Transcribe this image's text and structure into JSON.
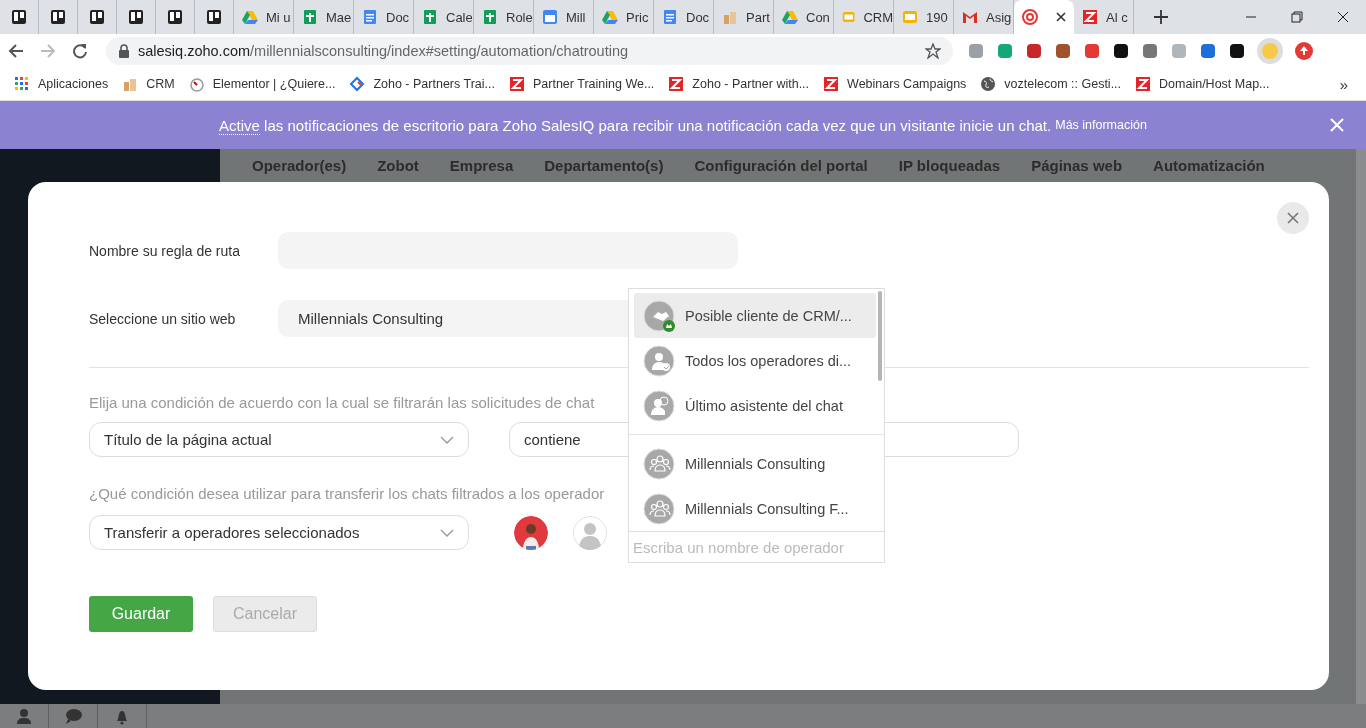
{
  "browser": {
    "tabs": [
      {
        "kind": "board",
        "selected": false
      },
      {
        "kind": "board",
        "selected": false
      },
      {
        "kind": "board",
        "selected": false
      },
      {
        "kind": "board",
        "selected": false
      },
      {
        "kind": "board",
        "selected": false
      },
      {
        "kind": "board",
        "selected": false
      },
      {
        "kind": "drive",
        "title": "Mi u",
        "selected": false
      },
      {
        "kind": "sheets",
        "title": "Mae",
        "selected": false
      },
      {
        "kind": "docs",
        "title": "Doc",
        "selected": false
      },
      {
        "kind": "sheets",
        "title": "Cale",
        "selected": false
      },
      {
        "kind": "sheets",
        "title": "Role",
        "selected": false
      },
      {
        "kind": "calendar",
        "title": "Mill",
        "selected": false
      },
      {
        "kind": "drive",
        "title": "Pric",
        "selected": false
      },
      {
        "kind": "docs",
        "title": "Doc",
        "selected": false
      },
      {
        "kind": "misc",
        "title": "Part",
        "selected": false
      },
      {
        "kind": "drive",
        "title": "Con",
        "selected": false
      },
      {
        "kind": "slides",
        "title": "CRM",
        "selected": false
      },
      {
        "kind": "slides",
        "title": "190",
        "selected": false
      },
      {
        "kind": "gmail",
        "title": "Asig",
        "selected": false
      },
      {
        "kind": "target",
        "selected": true
      },
      {
        "kind": "zoho",
        "title": "Al c",
        "selected": false
      }
    ],
    "url_host": "salesiq.zoho.com",
    "url_path": "/millennialsconsulting/index#setting/automation/chatrouting",
    "bookmarks": [
      {
        "kind": "apps",
        "title": "Aplicaciones"
      },
      {
        "kind": "misc",
        "title": "CRM"
      },
      {
        "kind": "page",
        "title": "Elementor | ¿Quiere..."
      },
      {
        "kind": "diamond",
        "title": "Zoho - Partners Trai..."
      },
      {
        "kind": "zoho",
        "title": "Partner Training We..."
      },
      {
        "kind": "zoho",
        "title": "Zoho - Partner with..."
      },
      {
        "kind": "zoho",
        "title": "Webinars Campaigns"
      },
      {
        "kind": "globe",
        "title": "voztelecom :: Gesti..."
      },
      {
        "kind": "zoho",
        "title": "Domain/Host Map..."
      }
    ],
    "bookmarks_more": "»"
  },
  "banner": {
    "link": "Active",
    "text": " las notificaciones de escritorio para Zoho SalesIQ para recibir una notificación cada vez que un visitante inicie un chat.",
    "more": "Más información"
  },
  "nav": [
    "Operador(es)",
    "Zobot",
    "Empresa",
    "Departamento(s)",
    "Configuración del portal",
    "IP bloqueadas",
    "Páginas web",
    "Automatización"
  ],
  "modal": {
    "name_label": "Nombre su regla de ruta",
    "site_label": "Seleccione un sitio web",
    "site_value": "Millennials Consulting",
    "condition_label": "Elija una condición de acuerdo con la cual se filtrarán las solicitudes de chat",
    "condition_field": "Título de la página actual",
    "operator_field": "contiene",
    "transfer_label": "¿Qué condición desea utilizar para transferir los chats filtrados a los operador",
    "transfer_field": "Transferir a operadores seleccionados",
    "dropdown": {
      "items": [
        {
          "kind": "crm",
          "label": "Posible cliente de CRM/...",
          "selected": true
        },
        {
          "kind": "available",
          "label": "Todos los operadores di...",
          "selected": false
        },
        {
          "kind": "last",
          "label": "Último asistente del chat",
          "selected": false
        },
        {
          "kind": "department",
          "label": "Millennials Consulting",
          "selected": false
        },
        {
          "kind": "department",
          "label": "Millennials Consulting F...",
          "selected": false
        }
      ],
      "placeholder": "Escriba un nombre de operador"
    },
    "buttons": [
      {
        "label": "Guardar",
        "disabled": false
      },
      {
        "label": "Cancelar",
        "disabled": true
      }
    ]
  }
}
